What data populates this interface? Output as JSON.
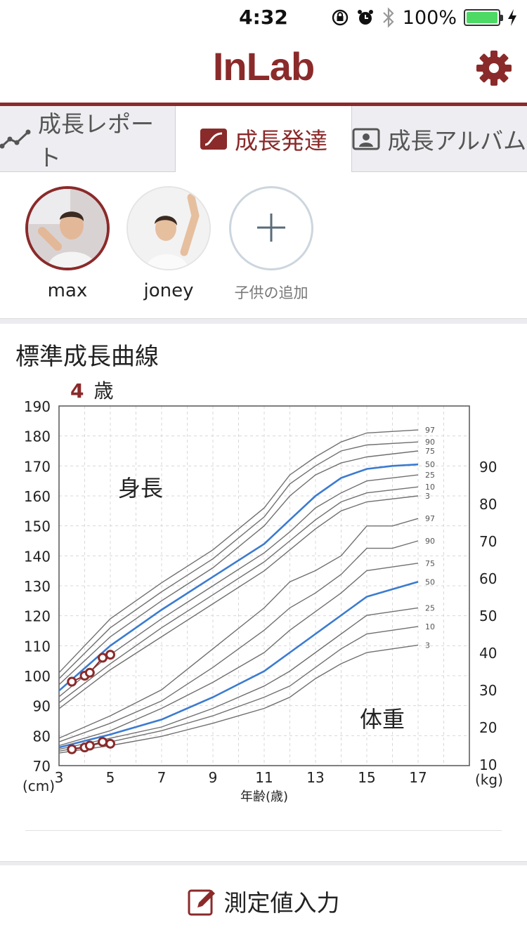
{
  "status": {
    "time": "4:32",
    "battery": "100%"
  },
  "app": {
    "logo": "InLab"
  },
  "tabs": [
    {
      "label": "成長レポート",
      "icon": "trend-line-icon"
    },
    {
      "label": "成長発達",
      "icon": "curve-icon",
      "active": true
    },
    {
      "label": "成長アルバム",
      "icon": "portrait-icon"
    }
  ],
  "children": [
    {
      "name": "max",
      "selected": true
    },
    {
      "name": "joney",
      "selected": false
    }
  ],
  "add_child_label": "子供の追加",
  "chart": {
    "title": "標準成長曲線",
    "age_value": "4",
    "age_unit": "歳",
    "height_label": "身長",
    "weight_label": "体重"
  },
  "chart_data": {
    "type": "line",
    "xlabel": "年齢(歳)",
    "x_ticks": [
      3,
      5,
      7,
      9,
      11,
      13,
      15,
      17
    ],
    "xlim": [
      3,
      19
    ],
    "y_left": {
      "unit": "(cm)",
      "ticks": [
        70,
        80,
        90,
        100,
        110,
        120,
        130,
        140,
        150,
        160,
        170,
        180,
        190
      ],
      "ylim": [
        70,
        190
      ]
    },
    "y_right": {
      "unit": "(kg)",
      "ticks": [
        10,
        20,
        30,
        40,
        50,
        60,
        70,
        80,
        90
      ],
      "ylim": [
        10,
        90
      ]
    },
    "grid": true,
    "colors": {
      "percentile": "#707070",
      "median": "#3b7bd0",
      "measurement": "#8b2a2a"
    },
    "height_series": [
      {
        "name": "97",
        "x": [
          3,
          5,
          7,
          9,
          11,
          12,
          13,
          14,
          15,
          17
        ],
        "y": [
          101,
          119,
          131,
          142,
          156,
          167,
          173,
          178,
          181,
          182
        ]
      },
      {
        "name": "90",
        "x": [
          3,
          5,
          7,
          9,
          11,
          12,
          13,
          14,
          15,
          17
        ],
        "y": [
          99,
          116,
          128,
          139,
          153,
          164,
          170,
          175,
          177,
          178
        ]
      },
      {
        "name": "75",
        "x": [
          3,
          5,
          7,
          9,
          11,
          12,
          13,
          14,
          15,
          17
        ],
        "y": [
          97,
          113,
          125,
          136,
          150,
          160,
          167,
          171,
          173,
          175
        ]
      },
      {
        "name": "50",
        "x": [
          3,
          5,
          7,
          9,
          11,
          12,
          13,
          14,
          15,
          16,
          17
        ],
        "y": [
          95,
          110,
          122,
          133,
          144,
          152,
          160,
          166,
          169,
          170,
          170.5
        ]
      },
      {
        "name": "25",
        "x": [
          3,
          5,
          7,
          9,
          11,
          12,
          13,
          14,
          15,
          17
        ],
        "y": [
          93,
          107,
          119,
          130,
          141,
          148,
          156,
          161,
          165,
          167
        ]
      },
      {
        "name": "10",
        "x": [
          3,
          5,
          7,
          9,
          11,
          12,
          13,
          14,
          15,
          17
        ],
        "y": [
          91,
          104,
          116,
          127,
          138,
          145,
          152,
          158,
          161,
          163
        ]
      },
      {
        "name": "3",
        "x": [
          3,
          5,
          7,
          9,
          11,
          12,
          13,
          14,
          15,
          17
        ],
        "y": [
          89,
          102,
          113,
          124,
          135,
          142,
          149,
          155,
          158,
          160
        ]
      }
    ],
    "weight_series": [
      {
        "name": "97",
        "x": [
          3,
          5,
          7,
          9,
          11,
          12,
          13,
          14,
          15,
          16,
          17
        ],
        "y": [
          17,
          23,
          30,
          41,
          52,
          59,
          62,
          66,
          74,
          74,
          76
        ]
      },
      {
        "name": "90",
        "x": [
          3,
          5,
          7,
          9,
          11,
          12,
          13,
          14,
          15,
          16,
          17
        ],
        "y": [
          16,
          21,
          27,
          36,
          46,
          52,
          56,
          61,
          68,
          68,
          70
        ]
      },
      {
        "name": "75",
        "x": [
          3,
          5,
          7,
          9,
          11,
          12,
          13,
          14,
          15,
          17
        ],
        "y": [
          15,
          19,
          25,
          32,
          40,
          46,
          51,
          56,
          62,
          64
        ]
      },
      {
        "name": "50",
        "x": [
          3,
          5,
          7,
          9,
          11,
          12,
          13,
          14,
          15,
          16,
          17
        ],
        "y": [
          14.5,
          18,
          22,
          28,
          35,
          40,
          45,
          50,
          55,
          57,
          59
        ]
      },
      {
        "name": "25",
        "x": [
          3,
          5,
          7,
          9,
          11,
          12,
          13,
          14,
          15,
          17
        ],
        "y": [
          14,
          17,
          20,
          25,
          31,
          35,
          40,
          45,
          50,
          52
        ]
      },
      {
        "name": "10",
        "x": [
          3,
          5,
          7,
          9,
          11,
          12,
          13,
          14,
          15,
          17
        ],
        "y": [
          13.5,
          16,
          19,
          23,
          28,
          31,
          36,
          41,
          45,
          47
        ]
      },
      {
        "name": "3",
        "x": [
          3,
          5,
          7,
          9,
          11,
          12,
          13,
          14,
          15,
          17
        ],
        "y": [
          13,
          15,
          17.5,
          21,
          25,
          28,
          33,
          37,
          40,
          42
        ]
      }
    ],
    "measurements": {
      "height": {
        "x": [
          3.5,
          4.0,
          4.2,
          4.7,
          5.0
        ],
        "y": [
          98,
          100,
          101,
          106,
          107
        ]
      },
      "weight": {
        "x": [
          3.5,
          4.0,
          4.2,
          4.7,
          5.0
        ],
        "y": [
          14,
          14.5,
          15,
          16,
          15.5
        ]
      }
    }
  },
  "bottom": {
    "label": "測定値入力"
  }
}
